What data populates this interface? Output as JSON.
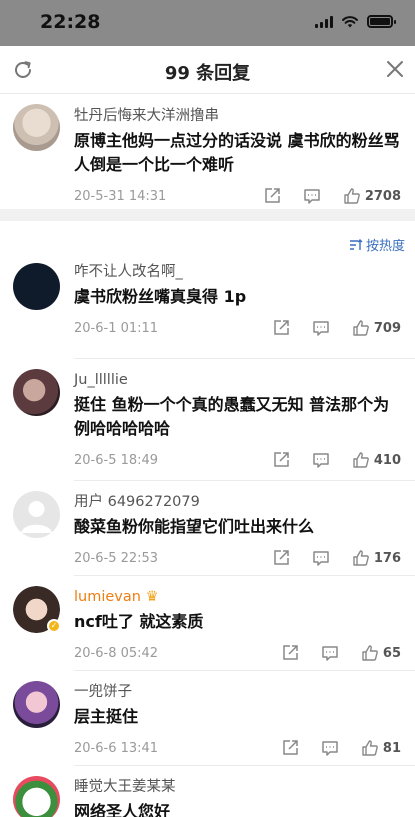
{
  "status_bar": {
    "time": "22:28"
  },
  "header": {
    "title": "99 条回复"
  },
  "main_comment": {
    "user": "牡丹后悔来大洋洲撸串",
    "text": "原博主他妈一点过分的话没说 虞书欣的粉丝骂人倒是一个比一个难听",
    "time": "20-5-31 14:31",
    "likes": "2708"
  },
  "sort": {
    "label": "按热度"
  },
  "replies": [
    {
      "user": "咋不让人改名啊_",
      "text": "虞书欣粉丝嘴真臭得 1p",
      "time": "20-6-1 01:11",
      "likes": "709"
    },
    {
      "user": "Ju_lllllie",
      "text": "挺住 鱼粉一个个真的愚蠢又无知 普法那个为例哈哈哈哈哈",
      "time": "20-6-5 18:49",
      "likes": "410"
    },
    {
      "user": "用户 6496272079",
      "text": "酸菜鱼粉你能指望它们吐出来什么",
      "time": "20-6-5 22:53",
      "likes": "176"
    },
    {
      "user": "lumievan",
      "text": "ncf吐了 就这素质",
      "time": "20-6-8 05:42",
      "likes": "65"
    },
    {
      "user": "一兜饼子",
      "text": "层主挺住",
      "time": "20-6-6 13:41",
      "likes": "81"
    },
    {
      "user": "睡觉大王姜某某",
      "text": "网络圣人您好",
      "time": "",
      "likes": ""
    }
  ],
  "colors": {
    "accent": "#3a6fbf",
    "vip_name": "#f07d12"
  }
}
